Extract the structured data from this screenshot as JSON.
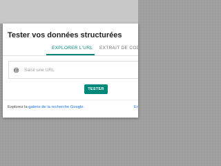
{
  "dialog": {
    "title": "Tester vos données structurées",
    "tabs": [
      {
        "label": "EXPLORER L'URL",
        "active": true
      },
      {
        "label": "EXTRAIT DE CODE",
        "active": false
      }
    ],
    "url_field": {
      "value": "",
      "placeholder": "Saisir une URL",
      "icon": "globe-icon"
    },
    "test_button_label": "TESTER",
    "footer": {
      "prefix": "Explorez la ",
      "link_label": "galerie de la recherche Google",
      "suffix": ".",
      "right_link_label": "En"
    },
    "colors": {
      "accent": "#00897b",
      "link": "#1a73e8",
      "backdrop": "#9e9e9e"
    }
  }
}
